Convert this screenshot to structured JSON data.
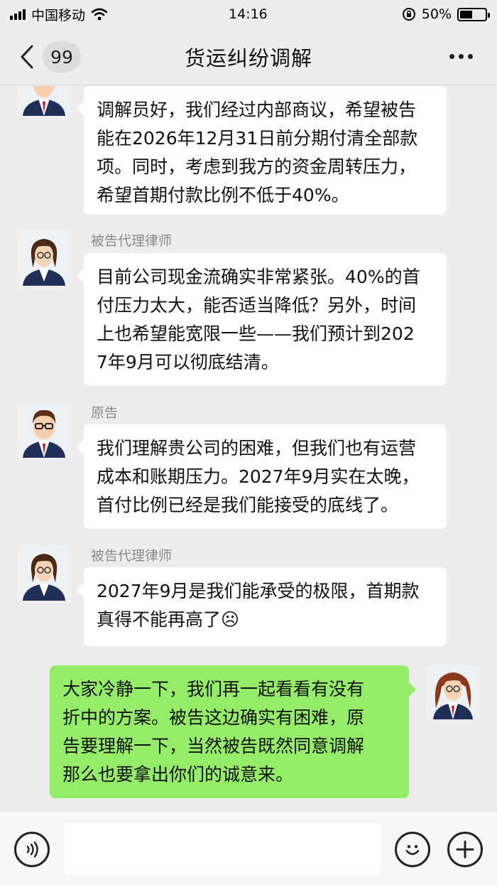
{
  "status_bar": {
    "carrier": "中国移动",
    "time": "14:16",
    "battery": "50%",
    "battery_level": 0.5
  },
  "nav": {
    "unread_count": "99",
    "title": "货运纠纷调解",
    "icons": {
      "back": "chevron-left-icon",
      "more": "more-dots-icon"
    }
  },
  "messages": [
    {
      "side": "left",
      "sender": "",
      "avatar": "male-lawyer-avatar",
      "lines": [
        "调解员好，我们经过内部商议，希望被告",
        "能在2026年12月31日前分期付清全部款",
        "项。同时，考虑到我方的资金周转压力，",
        "希望首期付款比例不低于40%。"
      ]
    },
    {
      "side": "left",
      "sender": "被告代理律师",
      "avatar": "female-lawyer-avatar",
      "lines": [
        "目前公司现金流确实非常紧张。40%的首",
        "付压力太大，能否适当降低？另外，时间",
        "上也希望能宽限一些——我们预计到202",
        "7年9月可以彻底结清。"
      ]
    },
    {
      "side": "left",
      "sender": "原告",
      "avatar": "male-plaintiff-avatar",
      "lines": [
        "我们理解贵公司的困难，但我们也有运营",
        "成本和账期压力。2027年9月实在太晚，",
        "首付比例已经是我们能接受的底线了。"
      ]
    },
    {
      "side": "left",
      "sender": "被告代理律师",
      "avatar": "female-lawyer-avatar",
      "lines": [
        "2027年9月是我们能承受的极限，首期款",
        "真得不能再高了☹"
      ]
    },
    {
      "side": "right",
      "sender": "",
      "avatar": "mediator-avatar",
      "lines": [
        "大家冷静一下，我们再一起看看有没有",
        "折中的方案。被告这边确实有困难，原",
        "告要理解一下，当然被告既然同意调解",
        "那么也要拿出你们的诚意来。"
      ]
    }
  ],
  "input_bar": {
    "placeholder": "",
    "icons": {
      "voice": "voice-icon",
      "emoji": "emoji-icon",
      "plus": "plus-icon"
    }
  },
  "colors": {
    "background": "#ededed",
    "bubble_left": "#ffffff",
    "bubble_right": "#95ec69",
    "sender_name": "#8a8a8a"
  }
}
